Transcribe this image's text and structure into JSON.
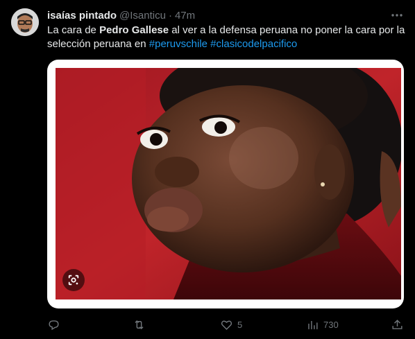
{
  "author": {
    "display_name": "isaías pintado",
    "handle": "@Isanticu",
    "separator": "·",
    "time_ago": "47m"
  },
  "tweet": {
    "text_before": "La cara de ",
    "text_bold": "Pedro Gallese",
    "text_after": " al ver a la defensa peruana no poner la cara por la selección peruana en ",
    "hashtag_1": "#peruvschile",
    "hashtag_2": "#clasicodelpacifico"
  },
  "actions": {
    "likes": "5",
    "views": "730"
  },
  "icons": {
    "more": "more-horizontal-icon",
    "lens": "google-lens-icon",
    "reply": "reply-icon",
    "retweet": "retweet-icon",
    "like": "heart-icon",
    "views": "views-icon",
    "share": "share-icon"
  },
  "colors": {
    "background": "#000000",
    "text": "#e7e9ea",
    "muted": "#71767b",
    "link": "#1d9bf0"
  }
}
